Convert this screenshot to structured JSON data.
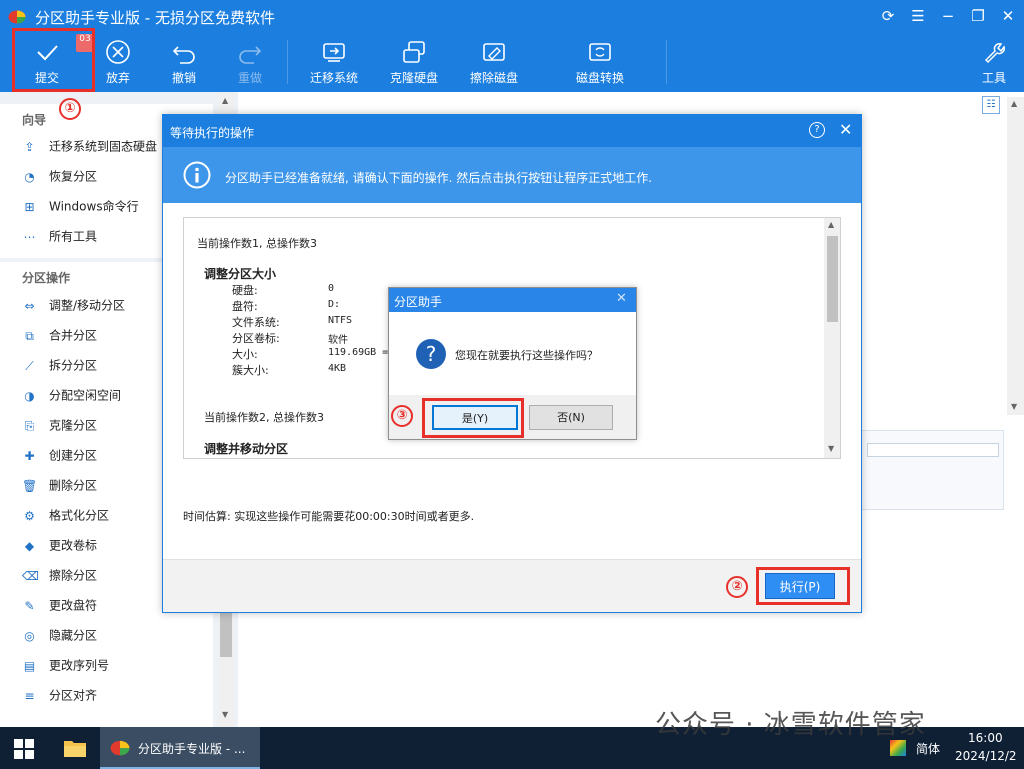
{
  "window": {
    "title": "分区助手专业版 - 无损分区免费软件"
  },
  "toolbar": {
    "commit_label": "提交",
    "pending_count": "03",
    "discard_label": "放弃",
    "undo_label": "撤销",
    "redo_label": "重做",
    "migrate_label": "迁移系统",
    "clone_label": "克隆硬盘",
    "wipe_label": "擦除磁盘",
    "convert_label": "磁盘转换",
    "tools_label": "工具"
  },
  "sidebar": {
    "wizard_heading": "向导",
    "wizard_items": [
      {
        "label": "迁移系统到固态硬盘",
        "icon": "ssd-migrate-icon"
      },
      {
        "label": "恢复分区",
        "icon": "recover-icon"
      },
      {
        "label": "Windows命令行",
        "icon": "windows-icon"
      },
      {
        "label": "所有工具",
        "icon": "more-icon"
      }
    ],
    "ops_heading": "分区操作",
    "ops_items": [
      {
        "label": "调整/移动分区",
        "icon": "resize-icon"
      },
      {
        "label": "合并分区",
        "icon": "merge-icon"
      },
      {
        "label": "拆分分区",
        "icon": "split-icon"
      },
      {
        "label": "分配空闲空间",
        "icon": "allocate-icon"
      },
      {
        "label": "克隆分区",
        "icon": "clone-icon"
      },
      {
        "label": "创建分区",
        "icon": "create-icon"
      },
      {
        "label": "删除分区",
        "icon": "delete-icon"
      },
      {
        "label": "格式化分区",
        "icon": "format-icon"
      },
      {
        "label": "更改卷标",
        "icon": "label-icon"
      },
      {
        "label": "擦除分区",
        "icon": "wipe-icon"
      },
      {
        "label": "更改盘符",
        "icon": "drive-letter-icon"
      },
      {
        "label": "隐藏分区",
        "icon": "hide-icon"
      },
      {
        "label": "更改序列号",
        "icon": "serial-icon"
      },
      {
        "label": "分区对齐",
        "icon": "align-icon"
      }
    ]
  },
  "pending_dialog": {
    "title": "等待执行的操作",
    "info": "分区助手已经准备就绪, 请确认下面的操作. 然后点击执行按钮让程序正式地工作.",
    "op1_header": "当前操作数1, 总操作数3",
    "op1_title": "调整分区大小",
    "op1_fields": [
      {
        "key": "硬盘:",
        "value": "0"
      },
      {
        "key": "盘符:",
        "value": "D:"
      },
      {
        "key": "文件系统:",
        "value": "NTFS"
      },
      {
        "key": "分区卷标:",
        "value": "软件"
      },
      {
        "key": "大小:",
        "value": "119.69GB ="
      },
      {
        "key": "簇大小:",
        "value": "4KB"
      }
    ],
    "op2_header": "当前操作数2, 总操作数3",
    "op2_title": "调整并移动分区",
    "estimate": "时间估算: 实现这些操作可能需要花00:00:30时间或者更多.",
    "execute_label": "执行(P)"
  },
  "confirm_dialog": {
    "title": "分区助手",
    "message": "您现在就要执行这些操作吗？",
    "yes_label": "是(Y)",
    "no_label": "否(N)"
  },
  "annotations": {
    "step1": "①",
    "step2": "②",
    "step3": "③"
  },
  "taskbar": {
    "app_label": "分区助手专业版 - ...",
    "ime": "简体",
    "time": "16:00",
    "date": "2024/12/2"
  },
  "watermark": "公众号 · 冰雪软件管家",
  "colors": {
    "accent": "#1c7fe0",
    "annotation_red": "#e8302a",
    "taskbar": "#0f2035"
  }
}
